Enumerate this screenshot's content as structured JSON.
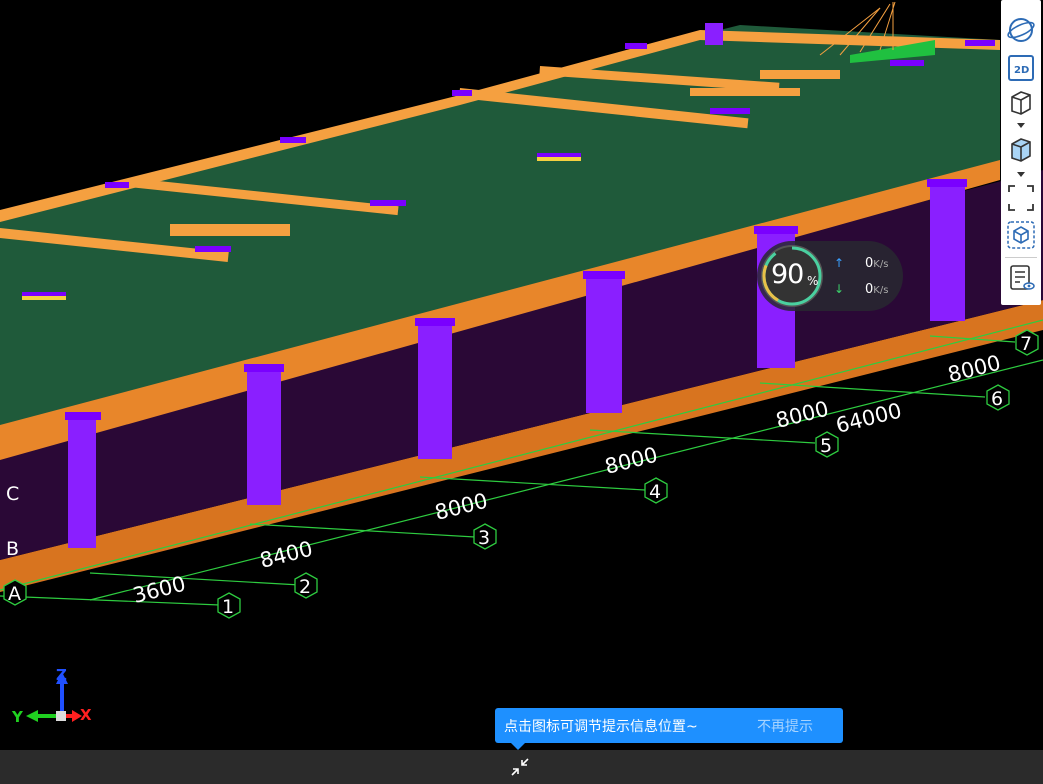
{
  "viewer": {
    "grid_dimensions": [
      "3600",
      "8400",
      "8000",
      "8000",
      "8000",
      "8000",
      "64000"
    ],
    "column_axes": [
      "1",
      "2",
      "3",
      "4",
      "5",
      "6",
      "7"
    ],
    "row_axes": [
      "A",
      "B",
      "C"
    ],
    "colors": {
      "slab": "#1f5a3a",
      "beam": "#f5a040",
      "column": "#8a1fff",
      "wall": "#2a0836",
      "grid": "#2ecc40"
    }
  },
  "toolbar": {
    "items": [
      {
        "name": "orbit-icon"
      },
      {
        "name": "view-2d-icon",
        "label": "2D"
      },
      {
        "name": "wireframe-cube-icon"
      },
      {
        "name": "shaded-cube-icon"
      },
      {
        "name": "fullscreen-icon"
      },
      {
        "name": "model-cube-icon"
      },
      {
        "name": "properties-icon"
      }
    ]
  },
  "perf": {
    "percent": "90",
    "percent_unit": "%",
    "upload_rate": "0",
    "download_rate": "0",
    "rate_unit": "K/s"
  },
  "tip": {
    "message": "点击图标可调节提示信息位置~",
    "dismiss": "不再提示"
  },
  "gizmo": {
    "x": "X",
    "y": "Y",
    "z": "Z"
  }
}
